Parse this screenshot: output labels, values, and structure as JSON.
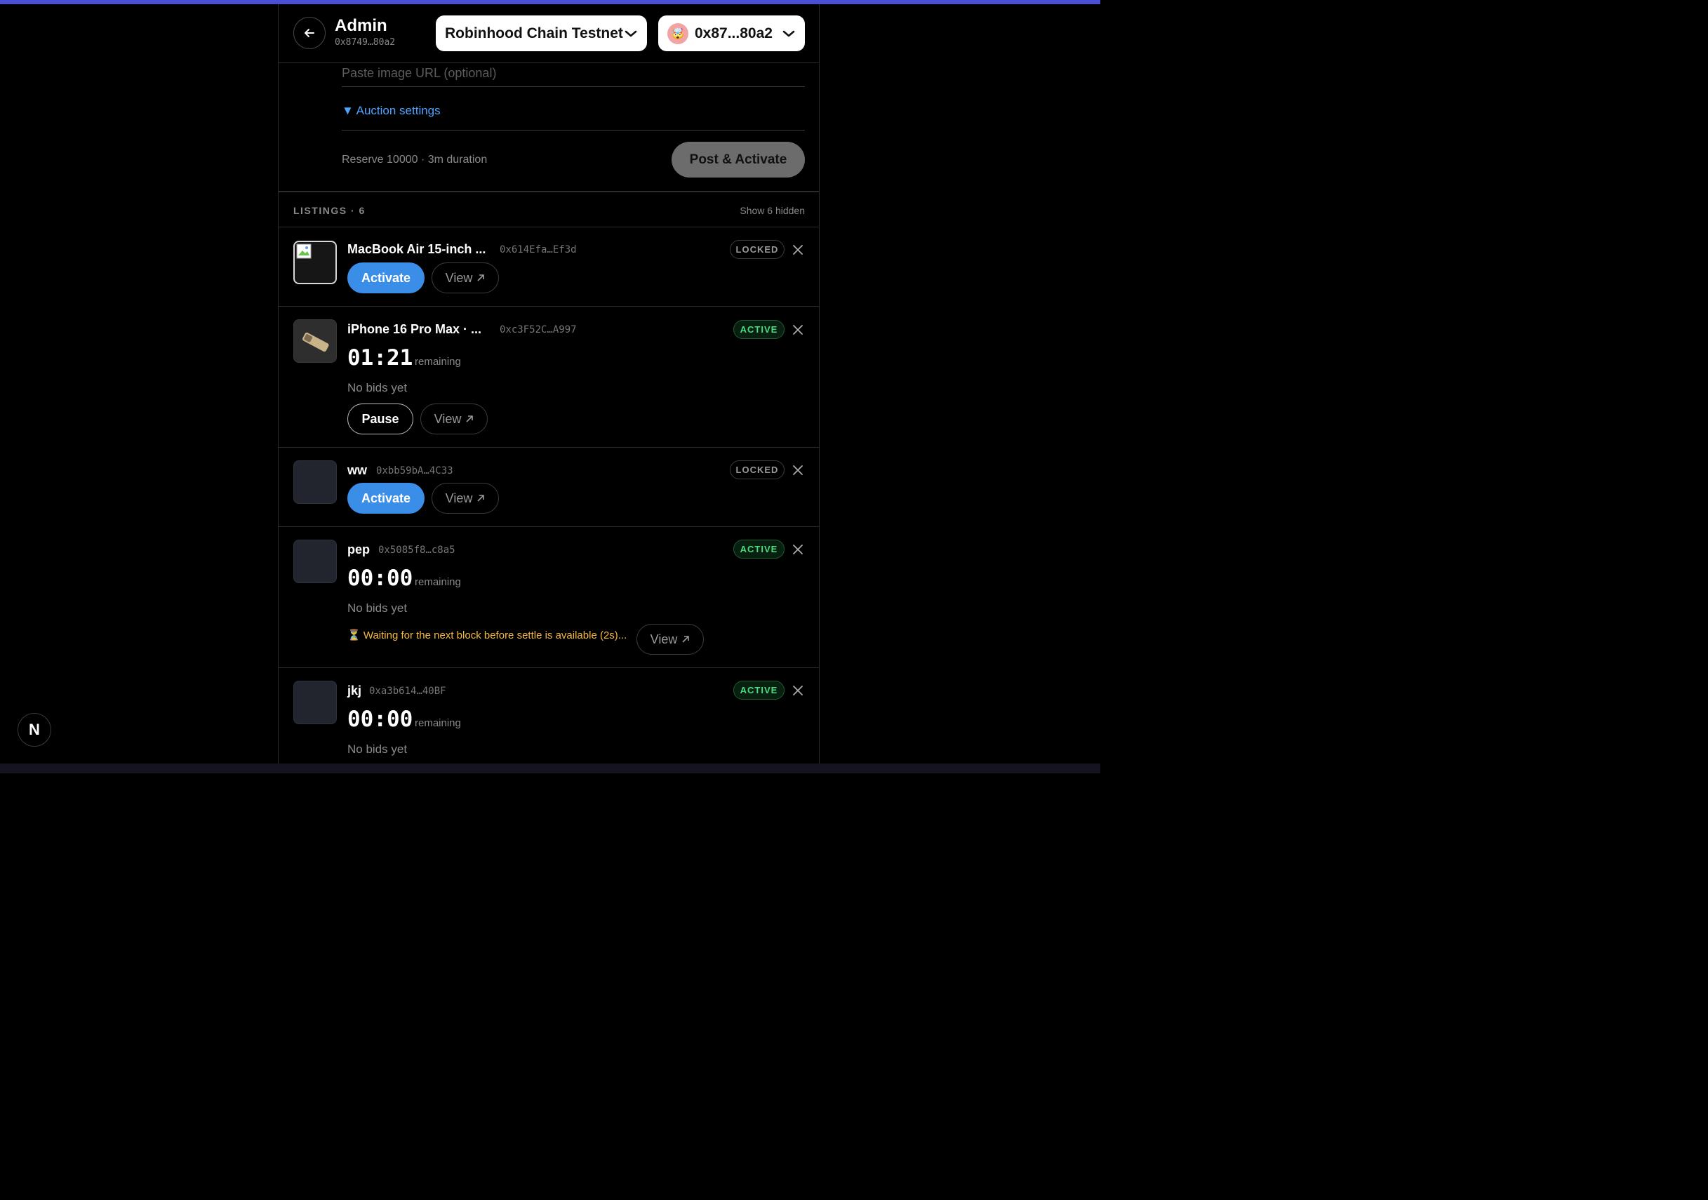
{
  "header": {
    "title": "Admin",
    "address": "0x8749…80a2",
    "network": "Robinhood Chain Testnet",
    "wallet": "0x87...80a2",
    "wallet_avatar": "🤯"
  },
  "form": {
    "image_url_placeholder": "Paste image URL (optional)",
    "auction_settings_label": "▼ Auction settings",
    "reserve_summary": "Reserve 10000 · 3m duration",
    "post_label": "Post & Activate"
  },
  "listings": {
    "title": "LISTINGS · 6",
    "toggle": "Show 6 hidden",
    "items": [
      {
        "name": "MacBook Air 15-inch ...",
        "address": "0x614Efa…Ef3d",
        "status": "LOCKED",
        "activate": "Activate",
        "view": "View"
      },
      {
        "name": "iPhone 16 Pro Max · ...",
        "address": "0xc3F52C…A997",
        "status": "ACTIVE",
        "timer": "01:21",
        "remaining": "remaining",
        "bids": "No bids yet",
        "pause": "Pause",
        "view": "View"
      },
      {
        "name": "ww",
        "address": "0xbb59bA…4C33",
        "status": "LOCKED",
        "activate": "Activate",
        "view": "View"
      },
      {
        "name": "pep",
        "address": "0x5085f8…c8a5",
        "status": "ACTIVE",
        "timer": "00:00",
        "remaining": "remaining",
        "bids": "No bids yet",
        "waiting": "⏳ Waiting for the next block before settle is available (2s)...",
        "view": "View"
      },
      {
        "name": "jkj",
        "address": "0xa3b614…40BF",
        "status": "ACTIVE",
        "timer": "00:00",
        "remaining": "remaining",
        "bids": "No bids yet"
      }
    ]
  },
  "dev_badge": "N",
  "colors": {
    "accent_blue": "#3b8ee8",
    "link_blue": "#4fa3ff",
    "active_green": "#4ade80",
    "warning_amber": "#f5b942",
    "top_bar": "#4a4fd6"
  }
}
